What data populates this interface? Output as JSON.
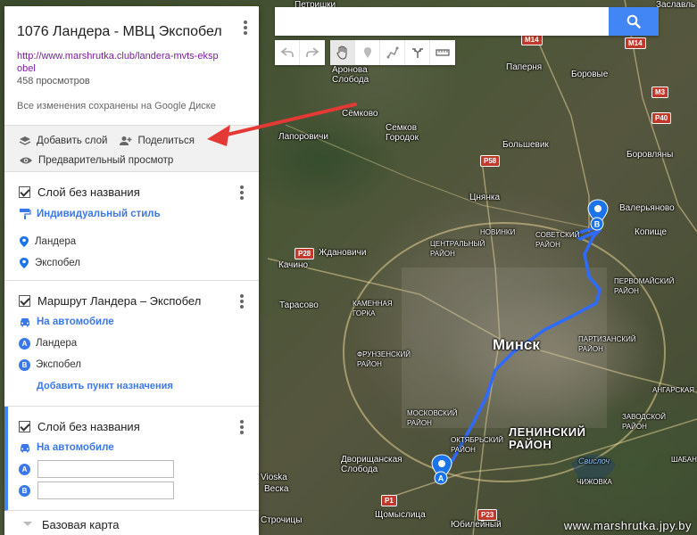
{
  "map": {
    "places": {
      "petrishki": "Петришки",
      "zaslavl": "Заславль",
      "aronova": "Аронова\nСлобода",
      "papernya": "Паперня",
      "borovye": "Боровые",
      "semkovo": "Сёмково",
      "semkov_gorodok": "Семков\nГородок",
      "lapor": "Лапоровичи",
      "bolshevik": "Большевик",
      "borovlyany": "Боровляны",
      "tsnyanka": "Цнянка",
      "valeryanovo": "Валерьяново",
      "novinki": "НОВИНКИ",
      "sovetsky": "СОВЕТСКИЙ\nРАЙОН",
      "kopishche": "Копище",
      "tsentralny": "ЦЕНТРАЛЬНЫЙ\nРАЙОН",
      "zhdanovichi": "Ждановичи",
      "kachino": "Качино",
      "pervomaysky": "ПЕРВОМАЙСКИЙ\nРАЙОН",
      "kamennaya": "КАМЕННАЯ\nГОРКА",
      "tarasovo": "Тарасово",
      "minsk": "Минск",
      "partizansky": "ПАРТИЗАНСКИЙ\nРАЙОН",
      "frunzensky": "ФРУНЗЕНСКИЙ\nРАЙОН",
      "angarskaya": "АНГАРСКАЯ",
      "moskovsky": "МОСКОВСКИЙ\nРАЙОН",
      "zavodskoy": "ЗАВОДСКОЙ\nРАЙОН",
      "oktyabrsky": "ОКТЯБРЬСКИЙ\nРАЙОН",
      "leninsky": "ЛЕНИНСКИЙ\nРАЙОН",
      "dvorishche": "Дворищанская\nСлобода",
      "shabany": "ШАБАНЫ",
      "vioska": "Vioska",
      "veska": "Веска",
      "chizhovka": "ЧИЖОВКА",
      "shchomyslitsa": "Щомыслица",
      "yubileyny": "Юбилейный",
      "strochitsy": "Строчицы",
      "lake": "Свислоч"
    },
    "roads": {
      "m14": "M14",
      "m14b": "M14",
      "m3": "M3",
      "p40": "P40",
      "p58": "P58",
      "p28": "P28",
      "p1": "P1",
      "p23": "P23"
    },
    "markers": {
      "a": "A",
      "b": "B"
    },
    "watermark": "www.marshrutka.jpy.by"
  },
  "search": {
    "value": "",
    "placeholder": ""
  },
  "toolbar": {
    "icons": [
      "undo-icon",
      "redo-icon",
      "hand-icon",
      "marker-icon",
      "draw-line-icon",
      "directions-icon",
      "ruler-icon"
    ]
  },
  "panel": {
    "title": "1076 Ландера - МВЦ Экспобел",
    "link": "http://www.marshrutka.club/landera-mvts-ekspobel",
    "views": "458 просмотров",
    "saved": "Все изменения сохранены на Google Диске",
    "actions": {
      "add_layer": "Добавить слой",
      "share": "Поделиться",
      "preview": "Предварительный просмотр"
    },
    "layers": [
      {
        "title": "Слой без названия",
        "style": "Индивидуальный стиль",
        "items": [
          "Ландера",
          "Экспобел"
        ]
      },
      {
        "title": "Маршрут Ландера – Экспобел",
        "mode": "На автомобиле",
        "points": [
          {
            "badge": "A",
            "label": "Ландера"
          },
          {
            "badge": "B",
            "label": "Экспобел"
          }
        ],
        "add_dest": "Добавить пункт назначения"
      },
      {
        "title": "Слой без названия",
        "mode": "На автомобиле",
        "points": [
          {
            "badge": "A",
            "value": ""
          },
          {
            "badge": "B",
            "value": ""
          }
        ]
      }
    ],
    "base_map": "Базовая карта"
  },
  "colors": {
    "accent": "#4285f4",
    "route": "#2f6bff",
    "annotation": "#e53935"
  }
}
